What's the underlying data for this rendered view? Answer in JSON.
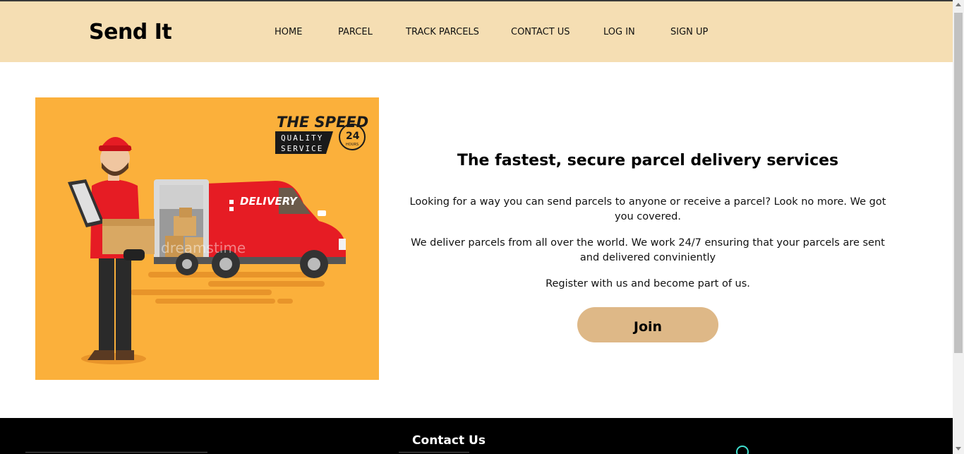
{
  "header": {
    "brand": "Send It",
    "nav": [
      {
        "label": "HOME"
      },
      {
        "label": "PARCEL"
      },
      {
        "label": "TRACK PARCELS"
      },
      {
        "label": "CONTACT US"
      },
      {
        "label": "LOG IN"
      },
      {
        "label": "SIGN UP"
      }
    ]
  },
  "hero": {
    "image": {
      "badge_title": "THE SPEED",
      "badge_line1": "QUALITY",
      "badge_line2": "SERVICE",
      "badge_hours": "24",
      "badge_hours_label": "HOURS",
      "van_label": "DELIVERY",
      "watermark": "dreamstime"
    },
    "heading": "The fastest, secure parcel delivery services",
    "paragraphs": [
      "Looking for a way you can send parcels to anyone or receive a parcel? Look no more. We got you covered.",
      "We deliver parcels from all over the world. We work 24/7 ensuring that your parcels are sent and delivered conviniently",
      "Register with us and become part of us."
    ],
    "join_label": "Join"
  },
  "footer": {
    "title": "Contact Us"
  },
  "colors": {
    "header_bg": "#f5deb3",
    "hero_bg": "#fbb03b",
    "join_bg": "#deb887",
    "footer_bg": "#000000"
  }
}
